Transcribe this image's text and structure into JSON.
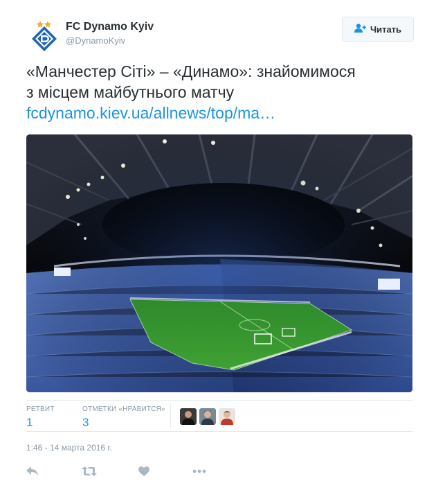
{
  "account": {
    "full_name": "FC Dynamo Kyiv",
    "screen_name": "@DynamoKyiv",
    "logo_icon": "dynamo-kyiv-crest-icon",
    "brand_color": "#2164b0"
  },
  "follow_button": {
    "label": "Читать",
    "icon": "add-user-icon"
  },
  "tweet": {
    "line1": "«Манчестер Сіті» – «Динамо»: знайомимося",
    "line2": "з місцем майбутнього матчу",
    "link": "fcdynamo.kiev.ua/allnews/top/ma…"
  },
  "media": {
    "subject": "stadium-photo"
  },
  "stats": {
    "retweets_label": "РЕТВИТ",
    "retweets_value": "1",
    "likes_label": "ОТМЕТКИ «НРАВИТСЯ»",
    "likes_value": "3"
  },
  "timestamp": "1:46 - 14 марта 2016 г.",
  "actions": [
    "reply-icon",
    "retweet-icon",
    "like-icon",
    "more-icon"
  ],
  "colors": {
    "link": "#1b95e0",
    "muted": "#8899a6",
    "text": "#292f33",
    "border": "#e1e8ed"
  }
}
